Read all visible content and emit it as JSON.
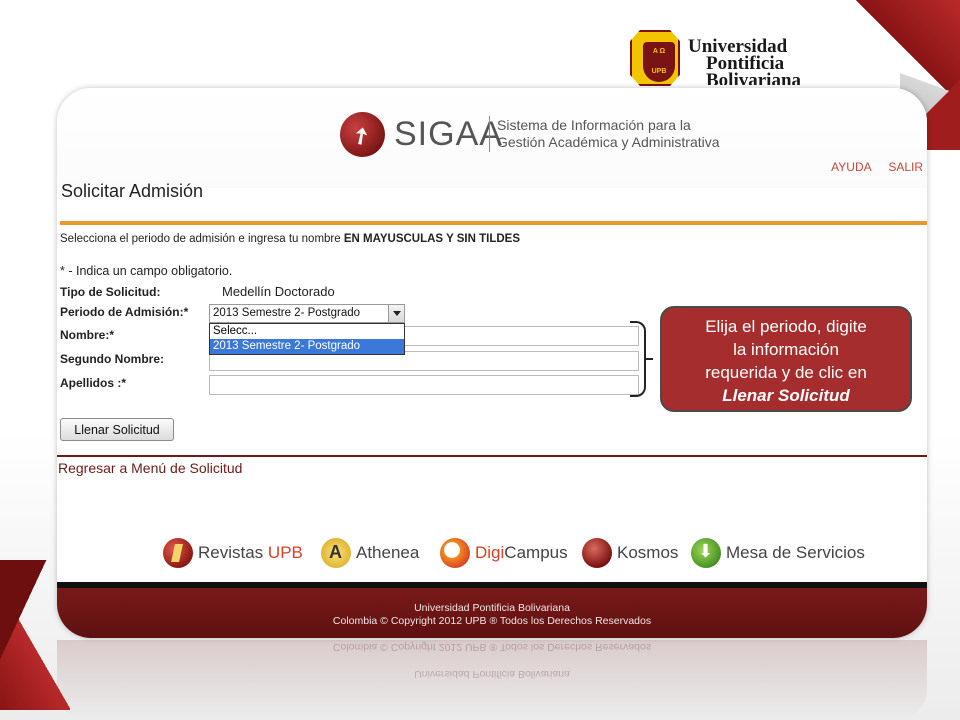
{
  "university": {
    "line1": "Universidad",
    "line2": "Pontificia",
    "line3": "Bolivariana",
    "crest_top": "A Ω",
    "crest_bottom": "UPB"
  },
  "header": {
    "brand": "SIGAA",
    "tagline_line1": "Sistema de Información para la",
    "tagline_line2": "Gestión Académica y Administrativa",
    "links": {
      "help": "AYUDA",
      "logout": "SALIR"
    }
  },
  "page": {
    "title": "Solicitar Admisión",
    "instruction_prefix": "Selecciona el periodo de admisión e ingresa tu nombre ",
    "instruction_bold": "EN MAYUSCULAS Y SIN TILDES",
    "required_note": "* - Indica un campo obligatorio."
  },
  "form": {
    "tipo_label": "Tipo de Solicitud:",
    "tipo_value": "Medellín Doctorado",
    "periodo_label": "Periodo de Admisión:*",
    "periodo_selected": "2013 Semestre 2- Postgrado",
    "periodo_options": [
      "Selecc...",
      "2013 Semestre 2- Postgrado"
    ],
    "nombre_label": "Nombre:*",
    "nombre_value": "",
    "segundo_label": "Segundo Nombre:",
    "segundo_value": "",
    "apellidos_label": "Apellidos :*",
    "apellidos_value": "",
    "submit_label": "Llenar Solicitud",
    "back_link": "Regresar a Menú de Solicitud"
  },
  "services": [
    {
      "name": "Revistas UPB",
      "prefix": "Revistas ",
      "accent": "UPB"
    },
    {
      "name": "Athenea"
    },
    {
      "name": "DigiCampus",
      "prefix": "Digi",
      "suffix": "Campus"
    },
    {
      "name": "Kosmos"
    },
    {
      "name": "Mesa de Servicios"
    }
  ],
  "footer": {
    "line1": "Universidad Pontificia Bolivariana",
    "line2": "Colombia © Copyright 2012 UPB ® Todos los Derechos Reservados"
  },
  "callout": {
    "text_line1": "Elija el periodo, digite",
    "text_line2": "la información",
    "text_line3": "requerida y de clic en",
    "text_em": "Llenar Solicitud"
  },
  "colors": {
    "brand_red": "#a62d2d",
    "accent_orange": "#e8962d",
    "link_red": "#c04a3e",
    "footer": "#6d1414"
  }
}
